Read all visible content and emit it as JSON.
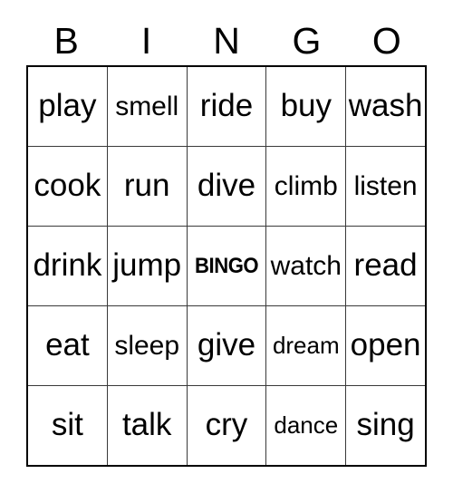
{
  "card": {
    "title": "BINGO",
    "header_letters": [
      "B",
      "I",
      "N",
      "G",
      "O"
    ],
    "text_color": "#000000",
    "background_color": "#ffffff",
    "border_color": "#000000",
    "grid_line_color": "#3a3a3a",
    "free_space_label": "BINGO",
    "rows": [
      [
        {
          "label": "play",
          "size": "lg",
          "free": false
        },
        {
          "label": "smell",
          "size": "md",
          "free": false
        },
        {
          "label": "ride",
          "size": "lg",
          "free": false
        },
        {
          "label": "buy",
          "size": "lg",
          "free": false
        },
        {
          "label": "wash",
          "size": "lg",
          "free": false
        }
      ],
      [
        {
          "label": "cook",
          "size": "lg",
          "free": false
        },
        {
          "label": "run",
          "size": "lg",
          "free": false
        },
        {
          "label": "dive",
          "size": "lg",
          "free": false
        },
        {
          "label": "climb",
          "size": "md",
          "free": false
        },
        {
          "label": "listen",
          "size": "md",
          "free": false
        }
      ],
      [
        {
          "label": "drink",
          "size": "lg",
          "free": false
        },
        {
          "label": "jump",
          "size": "lg",
          "free": false
        },
        {
          "label": "BINGO",
          "size": "free",
          "free": true
        },
        {
          "label": "watch",
          "size": "md",
          "free": false
        },
        {
          "label": "read",
          "size": "lg",
          "free": false
        }
      ],
      [
        {
          "label": "eat",
          "size": "lg",
          "free": false
        },
        {
          "label": "sleep",
          "size": "md",
          "free": false
        },
        {
          "label": "give",
          "size": "lg",
          "free": false
        },
        {
          "label": "dream",
          "size": "sm",
          "free": false
        },
        {
          "label": "open",
          "size": "lg",
          "free": false
        }
      ],
      [
        {
          "label": "sit",
          "size": "lg",
          "free": false
        },
        {
          "label": "talk",
          "size": "lg",
          "free": false
        },
        {
          "label": "cry",
          "size": "lg",
          "free": false
        },
        {
          "label": "dance",
          "size": "sm",
          "free": false
        },
        {
          "label": "sing",
          "size": "lg",
          "free": false
        }
      ]
    ]
  }
}
